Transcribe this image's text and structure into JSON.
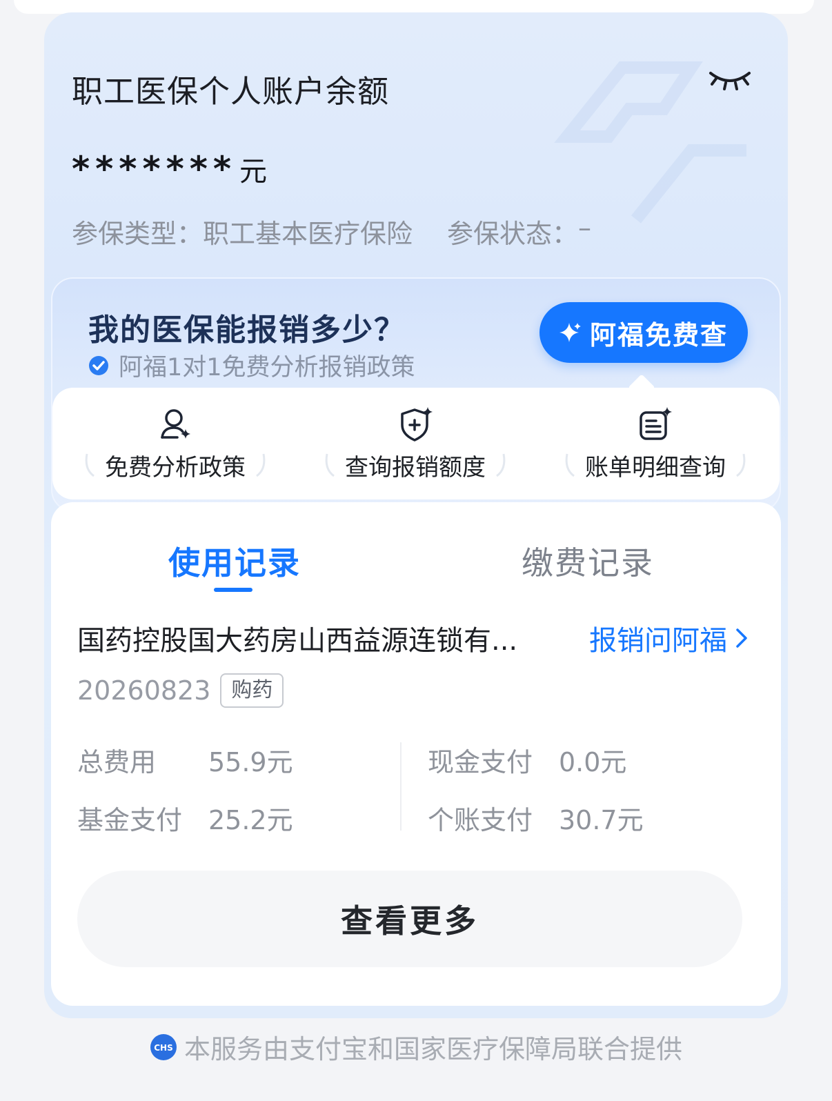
{
  "account": {
    "title": "职工医保个人账户余额",
    "balance_masked": "*******",
    "balance_unit": "元",
    "insurance_type_label": "参保类型：",
    "insurance_type_value": "职工基本医疗保险",
    "insurance_status_label": "参保状态：",
    "insurance_status_value": "–"
  },
  "promo": {
    "title": "我的医保能报销多少？",
    "subtitle": "阿福1对1免费分析报销政策",
    "cta_label": "阿福免费查",
    "features": [
      {
        "label": "免费分析政策",
        "icon": "user-sparkle-icon"
      },
      {
        "label": "查询报销额度",
        "icon": "shield-plus-icon"
      },
      {
        "label": "账单明细查询",
        "icon": "bill-list-icon"
      }
    ]
  },
  "records": {
    "tabs": [
      {
        "label": "使用记录",
        "active": true
      },
      {
        "label": "缴费记录",
        "active": false
      }
    ],
    "item": {
      "merchant": "国药控股国大药房山西益源连锁有...",
      "ask_link": "报销问阿福",
      "date": "20260823",
      "tag": "购药",
      "total_label": "总费用",
      "total_value": "55.9元",
      "fund_label": "基金支付",
      "fund_value": "25.2元",
      "cash_label": "现金支付",
      "cash_value": "0.0元",
      "personal_label": "个账支付",
      "personal_value": "30.7元"
    },
    "more_label": "查看更多"
  },
  "footer": {
    "text": "本服务由支付宝和国家医疗保障局联合提供",
    "logo_text": "CHS"
  },
  "colors": {
    "accent": "#1677ff",
    "card_bg": "#dde9fb"
  }
}
